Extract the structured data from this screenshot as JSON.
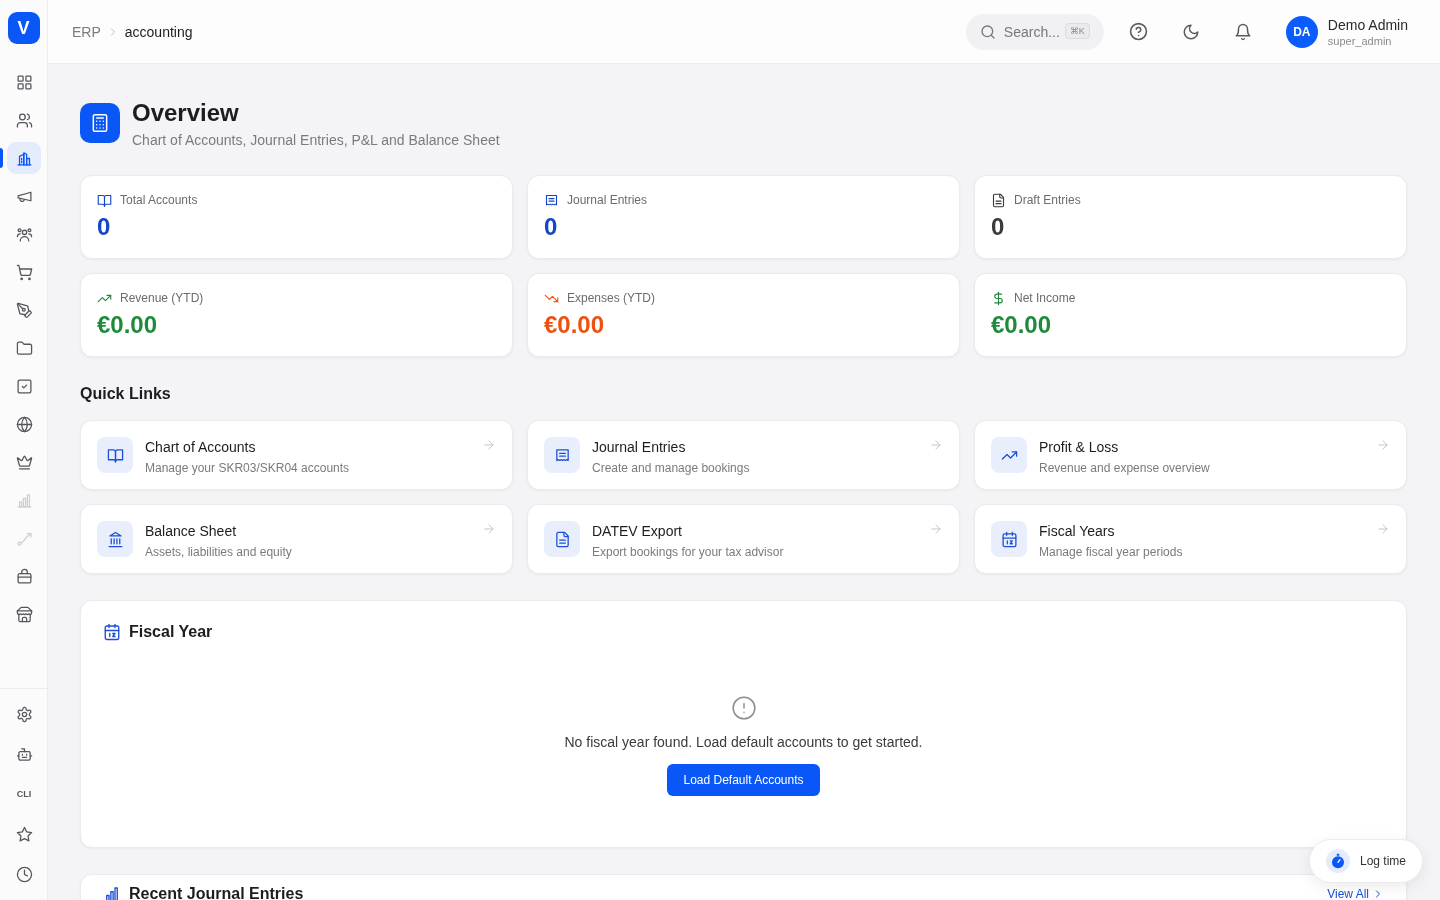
{
  "sidebar": {
    "logo": "V",
    "items": [
      {
        "selected": false,
        "disabled": false
      },
      {
        "selected": false,
        "disabled": false
      },
      {
        "selected": true,
        "disabled": false
      },
      {
        "selected": false,
        "disabled": false
      },
      {
        "selected": false,
        "disabled": false
      },
      {
        "selected": false,
        "disabled": false
      },
      {
        "selected": false,
        "disabled": false
      },
      {
        "selected": false,
        "disabled": false
      },
      {
        "selected": false,
        "disabled": false
      },
      {
        "selected": false,
        "disabled": false
      },
      {
        "selected": false,
        "disabled": false
      },
      {
        "selected": false,
        "disabled": true
      },
      {
        "selected": false,
        "disabled": true
      },
      {
        "selected": false,
        "disabled": false
      },
      {
        "selected": false,
        "disabled": false
      }
    ],
    "bottom_items": [
      {
        "kind": "icon",
        "selected": false
      },
      {
        "kind": "icon",
        "selected": false
      },
      {
        "kind": "text",
        "label": "CLI",
        "selected": false
      },
      {
        "kind": "icon",
        "selected": false
      },
      {
        "kind": "icon",
        "selected": false
      }
    ]
  },
  "header": {
    "breadcrumb": [
      {
        "label": "ERP",
        "current": false
      },
      {
        "label": "accounting",
        "current": true
      }
    ],
    "search": {
      "placeholder": "Search...",
      "shortcut": "⌘K"
    },
    "user": {
      "initials": "DA",
      "name": "Demo Admin",
      "role": "super_admin"
    }
  },
  "page": {
    "title": "Overview",
    "subtitle": "Chart of Accounts, Journal Entries, P&L and Balance Sheet"
  },
  "stats": [
    {
      "label": "Total Accounts",
      "value": "0",
      "color": "#1646c8"
    },
    {
      "label": "Journal Entries",
      "value": "0",
      "color": "#1646c8"
    },
    {
      "label": "Draft Entries",
      "value": "0",
      "color": "#3a3a3f"
    },
    {
      "label": "Revenue (YTD)",
      "value": "€0.00",
      "color": "#1f8a3c"
    },
    {
      "label": "Expenses (YTD)",
      "value": "€0.00",
      "color": "#f0500e"
    },
    {
      "label": "Net Income",
      "value": "€0.00",
      "color": "#1f8a3c"
    }
  ],
  "quick_links": {
    "title": "Quick Links",
    "items": [
      {
        "title": "Chart of Accounts",
        "description": "Manage your SKR03/SKR04 accounts"
      },
      {
        "title": "Journal Entries",
        "description": "Create and manage bookings"
      },
      {
        "title": "Profit & Loss",
        "description": "Revenue and expense overview"
      },
      {
        "title": "Balance Sheet",
        "description": "Assets, liabilities and equity"
      },
      {
        "title": "DATEV Export",
        "description": "Export bookings for your tax advisor"
      },
      {
        "title": "Fiscal Years",
        "description": "Manage fiscal year periods"
      }
    ]
  },
  "fiscal_year": {
    "title": "Fiscal Year",
    "message": "No fiscal year found. Load default accounts to get started.",
    "button": "Load Default Accounts"
  },
  "recent_entries": {
    "title": "Recent Journal Entries",
    "link": "View All"
  },
  "log_time": {
    "label": "Log time"
  }
}
